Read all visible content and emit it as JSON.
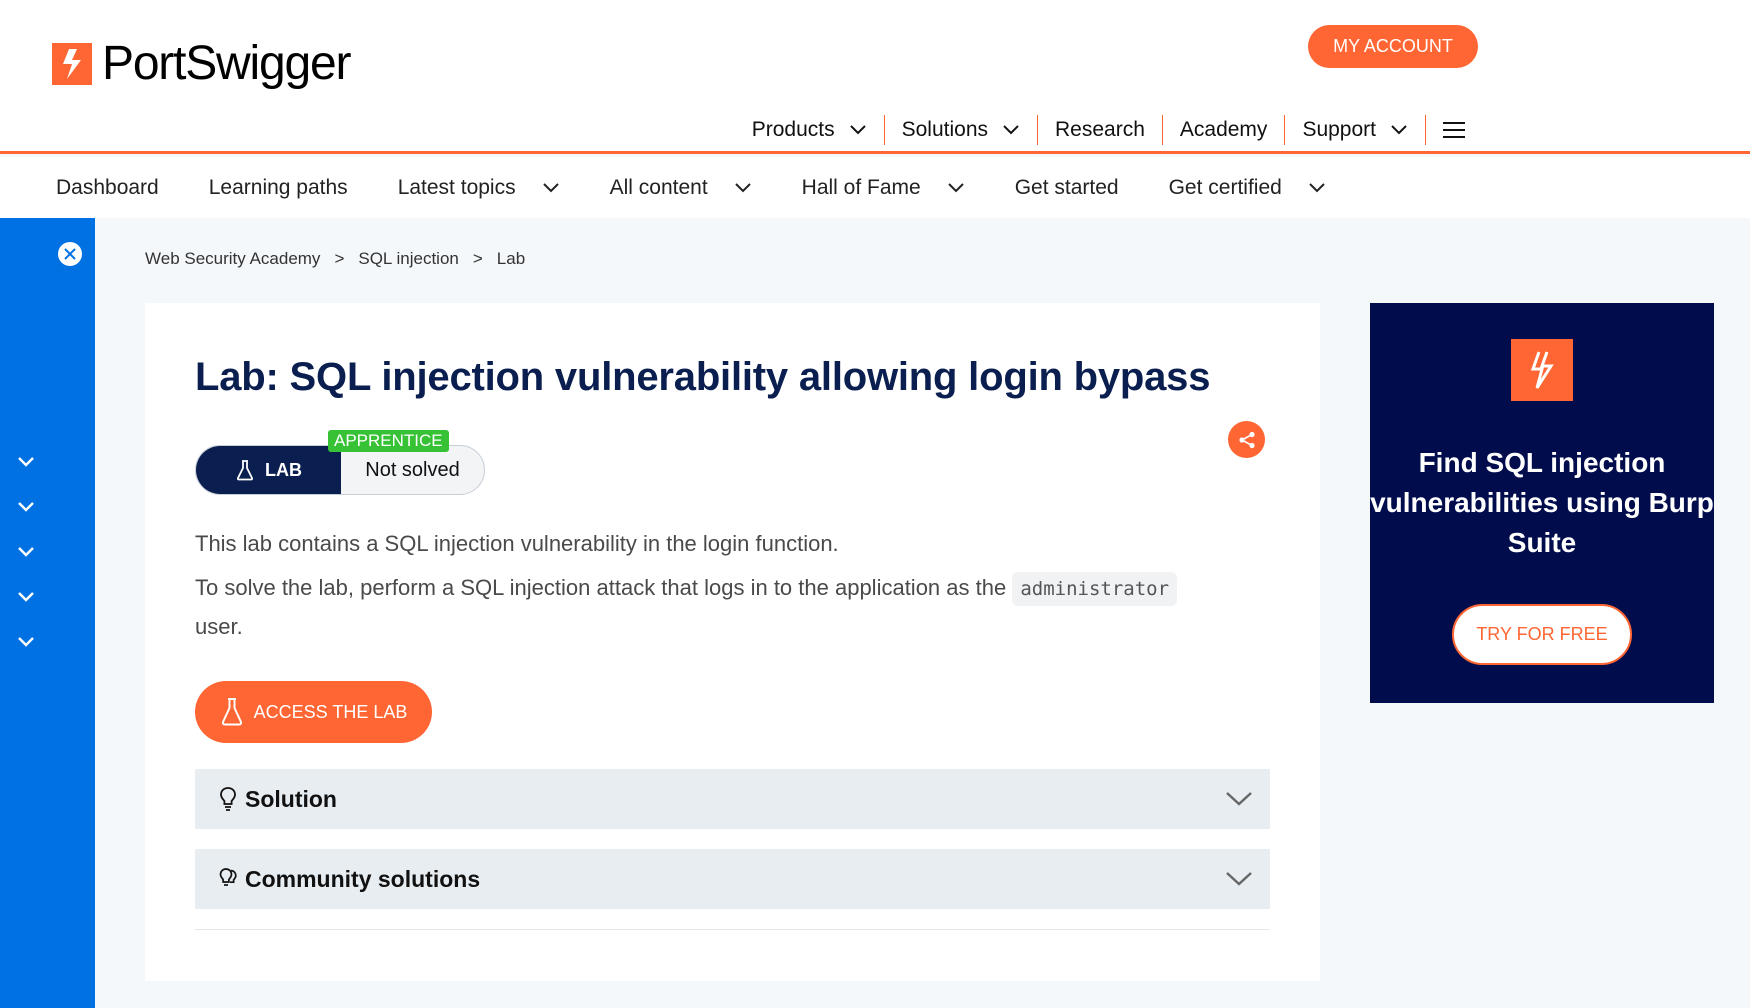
{
  "brand": {
    "name": "PortSwigger",
    "accent": "#ff6633",
    "navy": "#0a1f4f",
    "rail_blue": "#0071e3",
    "promo_bg": "#010c4c"
  },
  "header": {
    "my_account": "MY ACCOUNT",
    "nav": [
      {
        "label": "Products",
        "has_menu": true
      },
      {
        "label": "Solutions",
        "has_menu": true
      },
      {
        "label": "Research",
        "has_menu": false
      },
      {
        "label": "Academy",
        "has_menu": false
      },
      {
        "label": "Support",
        "has_menu": true
      }
    ],
    "menu_icon": "hamburger-icon"
  },
  "subnav": [
    {
      "label": "Dashboard"
    },
    {
      "label": "Learning paths"
    },
    {
      "label": "Latest topics",
      "has_menu": true
    },
    {
      "label": "All content",
      "has_menu": true
    },
    {
      "label": "Hall of Fame",
      "has_menu": true
    },
    {
      "label": "Get started"
    },
    {
      "label": "Get certified",
      "has_menu": true
    }
  ],
  "breadcrumb": [
    "Web Security Academy",
    "SQL injection",
    "Lab"
  ],
  "breadcrumb_sep": ">",
  "lab": {
    "title": "Lab: SQL injection vulnerability allowing login bypass",
    "level": "APPRENTICE",
    "type": "LAB",
    "status": "Not solved",
    "p1": "This lab contains a SQL injection vulnerability in the login function.",
    "p2_before": "To solve the lab, perform a SQL injection attack that logs in to the application as the",
    "p2_code": "administrator",
    "p2_after": "user.",
    "access_button": "ACCESS THE LAB",
    "sections": [
      {
        "label": "Solution",
        "icon": "lightbulb-icon"
      },
      {
        "label": "Community solutions",
        "icon": "lightbulbs-icon"
      }
    ]
  },
  "promo": {
    "title": "Find SQL injection vulnerabilities using Burp Suite",
    "button": "TRY FOR FREE"
  }
}
